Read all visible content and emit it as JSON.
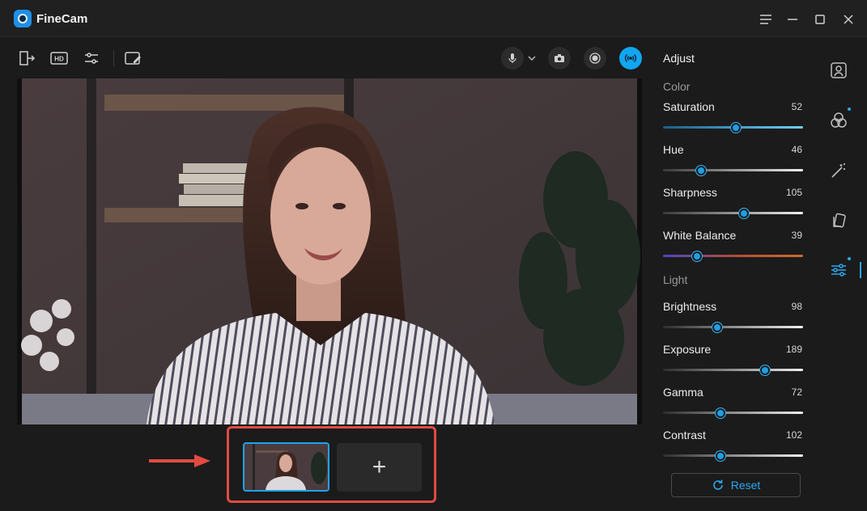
{
  "app": {
    "title": "FineCam"
  },
  "toolbar": {
    "icons": [
      "exit-icon",
      "hd-icon",
      "settings-sliders-icon",
      "whiteboard-icon"
    ],
    "right_icons": [
      "microphone-icon",
      "chevron-down-icon",
      "camera-icon",
      "record-icon",
      "live-icon"
    ]
  },
  "adjust": {
    "title": "Adjust",
    "sections": {
      "color": "Color",
      "light": "Light"
    },
    "sliders": [
      {
        "label": "Saturation",
        "value": "52",
        "level": 0.52
      },
      {
        "label": "Hue",
        "value": "46",
        "level": 0.27
      },
      {
        "label": "Sharpness",
        "value": "105",
        "level": 0.58
      },
      {
        "label": "White Balance",
        "value": "39",
        "level": 0.24
      },
      {
        "label": "Brightness",
        "value": "98",
        "level": 0.39
      },
      {
        "label": "Exposure",
        "value": "189",
        "level": 0.73
      },
      {
        "label": "Gamma",
        "value": "72",
        "level": 0.41
      },
      {
        "label": "Contrast",
        "value": "102",
        "level": 0.41
      }
    ],
    "reset_label": "Reset"
  },
  "scenes": {
    "add_label": "+"
  },
  "sidebar": {
    "icons": [
      "portrait-icon",
      "filters-icon",
      "magic-wand-icon",
      "stickers-icon",
      "adjust-sliders-icon"
    ],
    "active": "adjust-sliders-icon"
  },
  "colors": {
    "accent": "#1fa3ec",
    "annotation_red": "#e24a42",
    "background": "#1b1b1b"
  }
}
